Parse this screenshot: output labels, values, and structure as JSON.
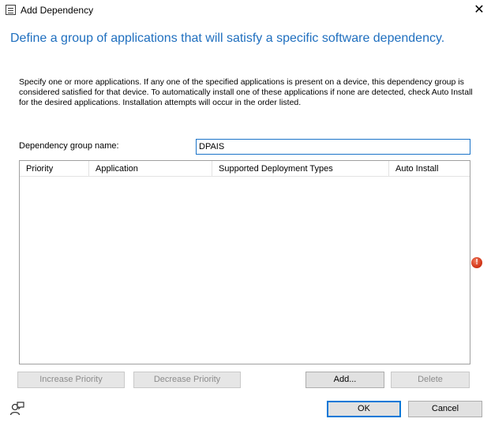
{
  "window": {
    "title": "Add Dependency",
    "close_glyph": "✕"
  },
  "headline": "Define a group of applications that will satisfy a specific software dependency.",
  "description": "Specify one or more applications. If any one of the specified applications is present on a device, this dependency group is considered satisfied for that device. To automatically install one of these applications if none are detected, check Auto Install for the desired applications. Installation attempts will occur in the order listed.",
  "group_name": {
    "label": "Dependency group name:",
    "value": "DPAIS"
  },
  "table": {
    "columns": [
      "Priority",
      "Application",
      "Supported Deployment Types",
      "Auto Install"
    ],
    "rows": []
  },
  "validation": {
    "icon": "error-icon",
    "glyph": "!",
    "color": "#d4381b"
  },
  "buttons": {
    "increase_priority": "Increase Priority",
    "decrease_priority": "Decrease Priority",
    "add": "Add...",
    "delete": "Delete",
    "ok": "OK",
    "cancel": "Cancel"
  },
  "colors": {
    "headline": "#1f6fbf",
    "focus_border": "#1a73c8"
  }
}
